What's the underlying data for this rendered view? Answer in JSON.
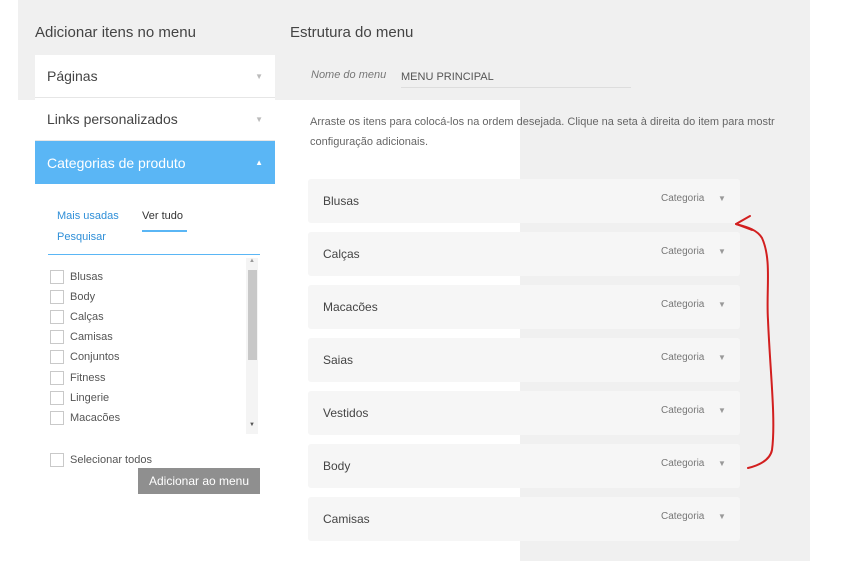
{
  "left": {
    "title": "Adicionar itens no menu",
    "sections": [
      {
        "label": "Páginas"
      },
      {
        "label": "Links personalizados"
      },
      {
        "label": "Categorias de produto"
      }
    ],
    "tabs": {
      "most_used": "Mais usadas",
      "view_all": "Ver tudo",
      "search": "Pesquisar"
    },
    "categories": [
      "Blusas",
      "Body",
      "Calças",
      "Camisas",
      "Conjuntos",
      "Fitness",
      "Lingerie",
      "Macacões"
    ],
    "select_all": "Selecionar todos",
    "add_button": "Adicionar ao menu"
  },
  "right": {
    "title": "Estrutura do menu",
    "menu_name_label": "Nome do menu",
    "menu_name_value": "MENU PRINCIPAL",
    "instructions_line1": "Arraste os itens para colocá-los na ordem desejada. Clique na seta à direita do item para mostr",
    "instructions_line2": "configuração adicionais.",
    "items": [
      {
        "title": "Blusas",
        "type": "Categoria"
      },
      {
        "title": "Calças",
        "type": "Categoria"
      },
      {
        "title": "Macacões",
        "type": "Categoria"
      },
      {
        "title": "Saias",
        "type": "Categoria"
      },
      {
        "title": "Vestidos",
        "type": "Categoria"
      },
      {
        "title": "Body",
        "type": "Categoria"
      },
      {
        "title": "Camisas",
        "type": "Categoria"
      }
    ]
  },
  "colors": {
    "accent": "#5ab6f5",
    "link": "#2f8fd8",
    "annotation": "#d21f1f"
  }
}
